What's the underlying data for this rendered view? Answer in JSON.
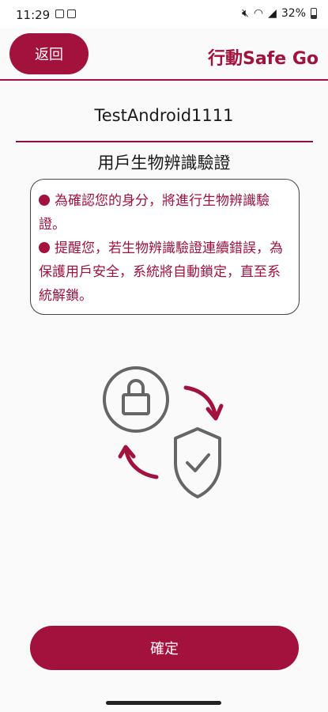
{
  "status_bar": {
    "time": "11:29",
    "battery": "32%"
  },
  "header": {
    "back_label": "返回",
    "app_title": "行動Safe Go"
  },
  "account": {
    "username": "TestAndroid1111"
  },
  "section": {
    "title": "用戶生物辨識驗證"
  },
  "notice": {
    "items": [
      "為確認您的身分，將進行生物辨識驗證。",
      "提醒您，若生物辨識驗證連續錯誤，為保護用戶安全，系統將自動鎖定，直至系統解鎖。"
    ]
  },
  "illustration": {
    "icons": [
      "lock-icon",
      "shield-check-icon",
      "arrow-icon"
    ]
  },
  "actions": {
    "confirm_label": "確定"
  },
  "colors": {
    "brand": "#a3113d",
    "icon_gray": "#666666"
  }
}
